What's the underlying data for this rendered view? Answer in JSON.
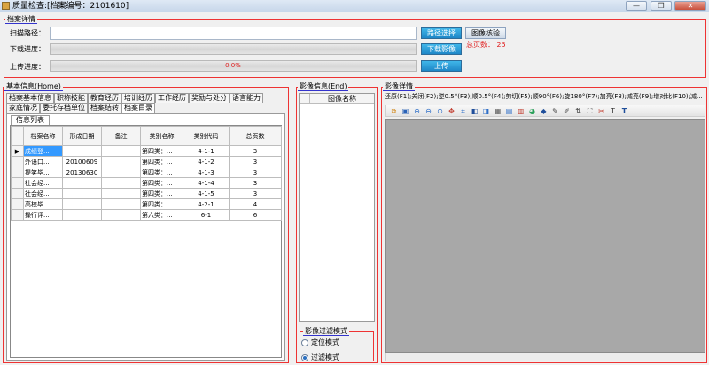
{
  "window": {
    "title": "质量检查:[档案编号：2101610]",
    "minimize_glyph": "—",
    "restore_glyph": "❐",
    "close_glyph": "✕"
  },
  "archive_detail": {
    "legend": "档案详情",
    "scan_path_label": "扫描路径：",
    "scan_path_value": "",
    "download_label": "下载进度：",
    "upload_label": "上传进度：",
    "upload_progress_text": "0.0%",
    "path_select_button": "路径选择",
    "image_verify_button": "图像核验",
    "download_image_button": "下载影像",
    "upload_button": "上传",
    "total_pages_label": "总页数：",
    "total_pages_value": "25"
  },
  "basic_info": {
    "legend": "基本信息(Home)",
    "tabs_row1": [
      "档案基本信息",
      "职称技能",
      "教育经历",
      "培训经历",
      "工作经历",
      "奖励与处分",
      "语言能力"
    ],
    "tabs_row2": [
      "家庭情况",
      "委托存档单位",
      "档案结转",
      "档案目录"
    ],
    "active_tab": "档案目录",
    "sub_tab": "信息列表",
    "columns": [
      "档案名称",
      "形成日期",
      "备注",
      "类别名称",
      "类别代码",
      "总页数"
    ],
    "rows": [
      {
        "name": "成绩登...",
        "date": "",
        "note": "",
        "cat": "第四类：...",
        "code": "4-1-1",
        "pages": "3",
        "selected": true
      },
      {
        "name": "外语口...",
        "date": "20100609",
        "note": "",
        "cat": "第四类：...",
        "code": "4-1-2",
        "pages": "3",
        "selected": false
      },
      {
        "name": "提笑毕...",
        "date": "20130630",
        "note": "",
        "cat": "第四类：...",
        "code": "4-1-3",
        "pages": "3",
        "selected": false
      },
      {
        "name": "社会经...",
        "date": "",
        "note": "",
        "cat": "第四类：...",
        "code": "4-1-4",
        "pages": "3",
        "selected": false
      },
      {
        "name": "社会经...",
        "date": "",
        "note": "",
        "cat": "第四类：...",
        "code": "4-1-5",
        "pages": "3",
        "selected": false
      },
      {
        "name": "高校毕...",
        "date": "",
        "note": "",
        "cat": "第四类：...",
        "code": "4-2-1",
        "pages": "4",
        "selected": false
      },
      {
        "name": "操行评...",
        "date": "",
        "note": "",
        "cat": "第六类：...",
        "code": "6-1",
        "pages": "6",
        "selected": false
      }
    ],
    "row_pointer": "▶"
  },
  "image_info": {
    "legend": "影像信息(End)",
    "column_header": "图像名称",
    "mode_legend": "影像过滤模式",
    "mode_locate": "定位模式",
    "mode_filter": "过滤模式",
    "selected_mode": "过滤模式"
  },
  "image_detail": {
    "legend": "影像详情",
    "shortcuts": "还原(F1);关闭(F2);逆0.5°(F3);顺0.5°(F4);剪切(F5);顺90°(F6);旋180°(F7);加亮(F8);减亮(F9);增对比(F10);减..."
  },
  "toolbar_icons": [
    {
      "name": "copy-icon",
      "glyph": "⧉",
      "color": "#d28a1e"
    },
    {
      "name": "fit-icon",
      "glyph": "▣",
      "color": "#2b63b8"
    },
    {
      "name": "zoom-in-icon",
      "glyph": "⊕",
      "color": "#2f6fc8"
    },
    {
      "name": "zoom-out-icon",
      "glyph": "⊖",
      "color": "#2f6fc8"
    },
    {
      "name": "zoom-reset-icon",
      "glyph": "⊙",
      "color": "#2f6fc8"
    },
    {
      "name": "move-icon",
      "glyph": "✥",
      "color": "#c0392b"
    },
    {
      "name": "crop-icon",
      "glyph": "⌗",
      "color": "#2f6fc8"
    },
    {
      "name": "contrast-icon",
      "glyph": "◧",
      "color": "#1f4e9a"
    },
    {
      "name": "brightness-icon",
      "glyph": "◨",
      "color": "#2f6fc8"
    },
    {
      "name": "grayscale-icon",
      "glyph": "▦",
      "color": "#555555"
    },
    {
      "name": "grid-icon",
      "glyph": "▤",
      "color": "#2f6fc8"
    },
    {
      "name": "color-icon",
      "glyph": "▥",
      "color": "#c0392b"
    },
    {
      "name": "palette-icon",
      "glyph": "◕",
      "color": "#2aa05a"
    },
    {
      "name": "rotate-icon",
      "glyph": "◆",
      "color": "#1f4e9a"
    },
    {
      "name": "pen-icon",
      "glyph": "✎",
      "color": "#444444"
    },
    {
      "name": "tool-icon",
      "glyph": "✐",
      "color": "#444444"
    },
    {
      "name": "flip-icon",
      "glyph": "⇅",
      "color": "#333333"
    },
    {
      "name": "fullscreen-icon",
      "glyph": "⛶",
      "color": "#333333"
    },
    {
      "name": "stamp-icon",
      "glyph": "✂",
      "color": "#c0392b"
    },
    {
      "name": "text-icon",
      "glyph": "T",
      "color": "#333333"
    },
    {
      "name": "text-bold-icon",
      "glyph": "T",
      "color": "#1f4e9a"
    }
  ],
  "colors": {
    "group_border": "#ee3333",
    "accent_blue": "#1e87c7",
    "selection": "#3399ff",
    "canvas": "#a8a8a8",
    "total_red": "#e02020"
  }
}
